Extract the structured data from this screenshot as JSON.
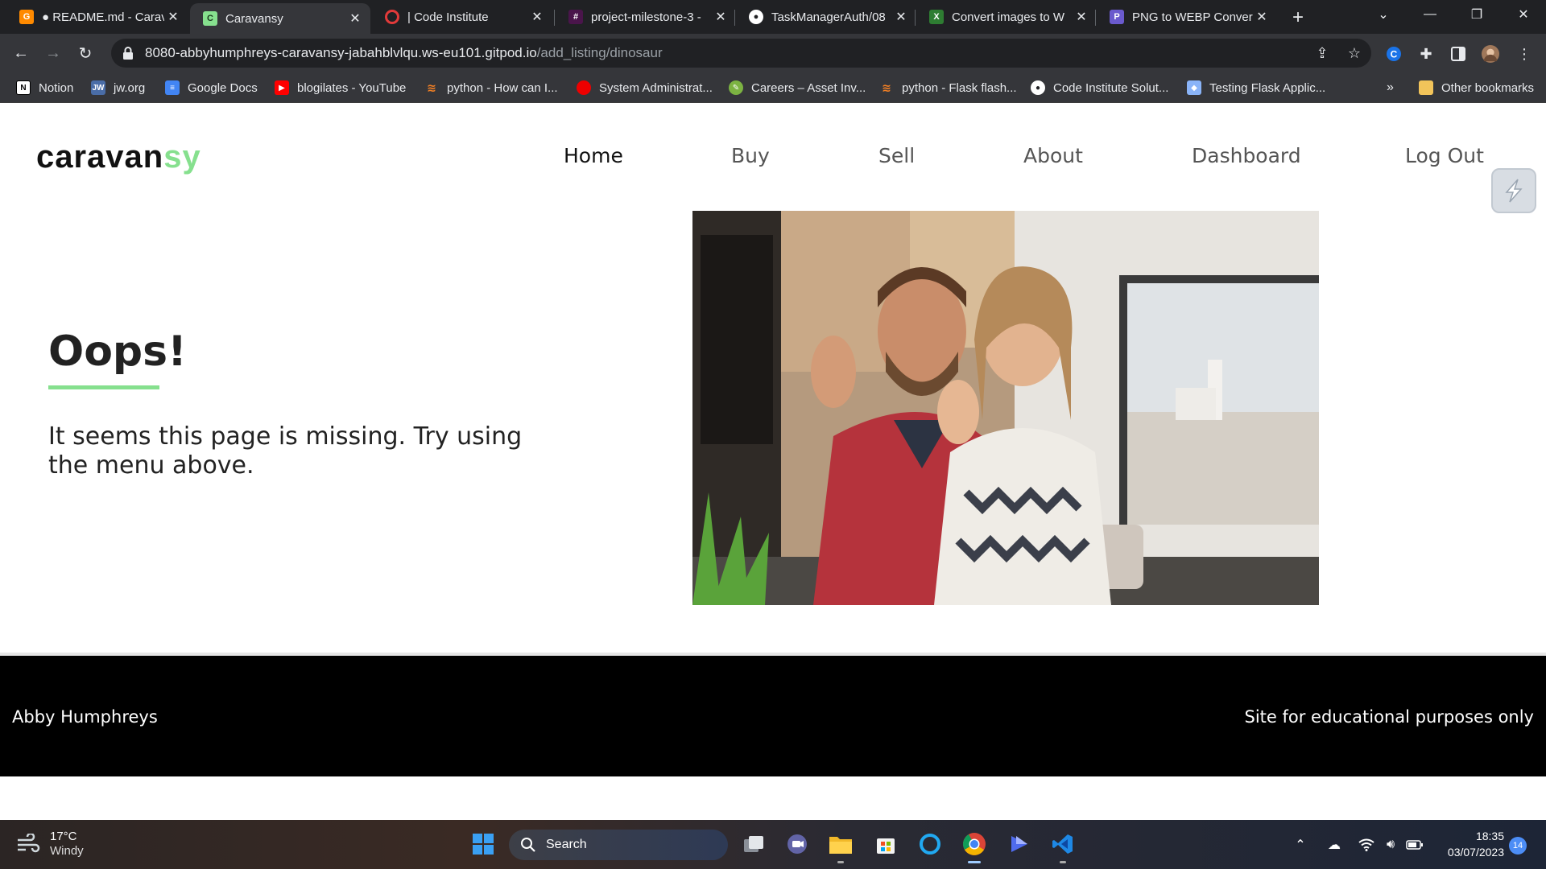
{
  "browser": {
    "tabs": [
      {
        "title": "● README.md - Carav",
        "icon": "gitpod-icon",
        "color": "#ff8a00"
      },
      {
        "title": "Caravansy",
        "icon": "caravansy-favicon",
        "color": "#86e08e"
      },
      {
        "title": "| Code Institute",
        "icon": "code-institute-icon",
        "color": "#e23a3a"
      },
      {
        "title": "project-milestone-3 -",
        "icon": "slack-icon",
        "color": "#e01e5a"
      },
      {
        "title": "TaskManagerAuth/08",
        "icon": "github-icon",
        "color": "#ffffff"
      },
      {
        "title": "Convert images to W",
        "icon": "convert-icon",
        "color": "#2e7d32"
      },
      {
        "title": "PNG to WEBP Conver",
        "icon": "png-webp-icon",
        "color": "#6a5acd"
      }
    ],
    "active_tab": 1,
    "url_host": "8080-abbyhumphreys-caravansy-jabahblvlqu.ws-eu101.gitpod.io",
    "url_path": "/add_listing/dinosaur",
    "bookmarks": [
      {
        "label": "Notion",
        "icon": "notion-icon",
        "color": "#ffffff"
      },
      {
        "label": "jw.org",
        "icon": "jw-icon",
        "color": "#4a6da7"
      },
      {
        "label": "Google Docs",
        "icon": "google-docs-icon",
        "color": "#4285f4"
      },
      {
        "label": "blogilates - YouTube",
        "icon": "youtube-icon",
        "color": "#ff0000"
      },
      {
        "label": "python - How can I...",
        "icon": "stackoverflow-icon",
        "color": "#f48024"
      },
      {
        "label": "System Administrat...",
        "icon": "redhat-icon",
        "color": "#ee0000"
      },
      {
        "label": "Careers – Asset Inv...",
        "icon": "careers-icon",
        "color": "#7cb342"
      },
      {
        "label": "python - Flask flash...",
        "icon": "stackoverflow-icon",
        "color": "#f48024"
      },
      {
        "label": "Code Institute Solut...",
        "icon": "github-icon",
        "color": "#ffffff"
      },
      {
        "label": "Testing Flask Applic...",
        "icon": "flask-icon",
        "color": "#8ab4f8"
      }
    ],
    "more_bookmarks": "»",
    "other_bookmarks": "Other bookmarks"
  },
  "site": {
    "logo_main": "caravan",
    "logo_accent": "sy",
    "accent_color": "#86e08e",
    "nav": [
      "Home",
      "Buy",
      "Sell",
      "About",
      "Dashboard",
      "Log Out"
    ],
    "heading": "Oops!",
    "message": "It seems this page is missing. Try using the menu above.",
    "photo_alt": "couple waving from campervan",
    "footer_left": "Abby Humphreys",
    "footer_right": "Site for educational purposes only"
  },
  "taskbar": {
    "temperature": "17°C",
    "condition": "Windy",
    "search_label": "Search",
    "time": "18:35",
    "date": "03/07/2023",
    "notifications": "14"
  }
}
